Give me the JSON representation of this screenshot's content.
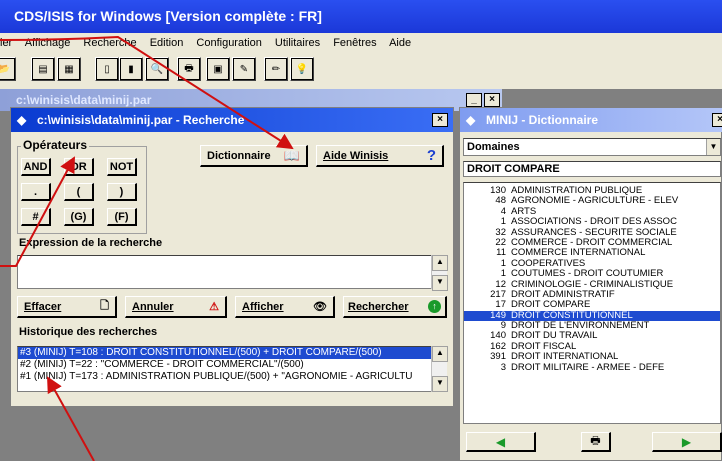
{
  "app": {
    "title": "CDS/ISIS for Windows [Version complète : FR]"
  },
  "menu": [
    "ier",
    "Affichage",
    "Recherche",
    "Edition",
    "Configuration",
    "Utilitaires",
    "Fenêtres",
    "Aide"
  ],
  "background_window": {
    "title": "c:\\winisis\\data\\minij.par"
  },
  "search_window": {
    "title": "c:\\winisis\\data\\minij.par - Recherche",
    "operators_label": "Opérateurs",
    "operators": [
      [
        "AND",
        "OR",
        "NOT"
      ],
      [
        ".",
        "(",
        ")"
      ],
      [
        "#",
        "(G)",
        "(F)"
      ]
    ],
    "dictionary_button": "Dictionnaire",
    "help_button": "Aide Winisis",
    "expression_label": "Expression de la recherche",
    "expression_value": "",
    "clear_button": "Effacer",
    "cancel_button": "Annuler",
    "display_button": "Afficher",
    "search_button": "Rechercher",
    "history_label": "Historique des recherches",
    "history": [
      "#3 (MINIJ) T=108 : DROIT CONSTITUTIONNEL/(500) + DROIT COMPARE/(500)",
      "#2 (MINIJ) T=22 : \"COMMERCE - DROIT COMMERCIAL\"/(500)",
      "#1 (MINIJ) T=173 : ADMINISTRATION PUBLIQUE/(500) + \"AGRONOMIE - AGRICULTU"
    ]
  },
  "dictionary_window": {
    "title": "MINIJ - Dictionnaire",
    "field_select": "Domaines",
    "current_term": "DROIT COMPARE",
    "terms": [
      {
        "count": "130",
        "term": "ADMINISTRATION PUBLIQUE"
      },
      {
        "count": "48",
        "term": "AGRONOMIE - AGRICULTURE - ELEV"
      },
      {
        "count": "4",
        "term": "ARTS"
      },
      {
        "count": "1",
        "term": "ASSOCIATIONS - DROIT DES ASSOC"
      },
      {
        "count": "32",
        "term": "ASSURANCES - SECURITE SOCIALE"
      },
      {
        "count": "22",
        "term": "COMMERCE - DROIT COMMERCIAL"
      },
      {
        "count": "11",
        "term": "COMMERCE INTERNATIONAL"
      },
      {
        "count": "1",
        "term": "COOPERATIVES"
      },
      {
        "count": "1",
        "term": "COUTUMES - DROIT COUTUMIER"
      },
      {
        "count": "12",
        "term": "CRIMINOLOGIE - CRIMINALISTIQUE"
      },
      {
        "count": "217",
        "term": "DROIT ADMINISTRATIF"
      },
      {
        "count": "17",
        "term": "DROIT COMPARE"
      },
      {
        "count": "149",
        "term": "DROIT CONSTITUTIONNEL"
      },
      {
        "count": "9",
        "term": "DROIT DE L'ENVIRONNEMENT"
      },
      {
        "count": "140",
        "term": "DROIT DU TRAVAIL"
      },
      {
        "count": "162",
        "term": "DROIT FISCAL"
      },
      {
        "count": "391",
        "term": "DROIT INTERNATIONAL"
      },
      {
        "count": "3",
        "term": "DROIT MILITAIRE - ARMEE - DEFE"
      }
    ],
    "selected_index": 12
  },
  "colors": {
    "title_active": "#0a3bd0",
    "selection": "#1e4bd0",
    "annotation_arrow": "#d01010"
  }
}
